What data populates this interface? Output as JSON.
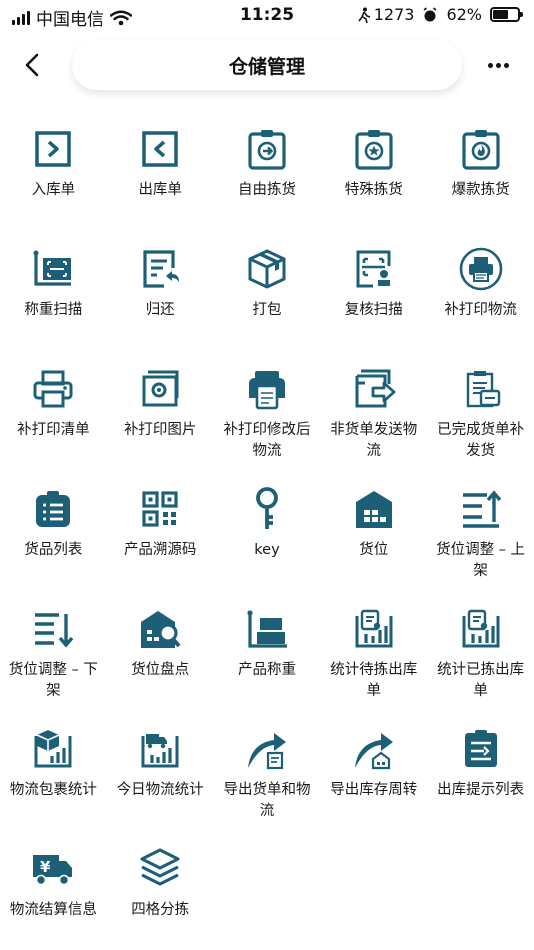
{
  "status": {
    "carrier": "中国电信",
    "time": "11:25",
    "steps": "1273",
    "battery": "62%",
    "battery_level": 0.62
  },
  "nav": {
    "title": "仓储管理"
  },
  "colors": {
    "icon": "#1e5f78"
  },
  "items": [
    {
      "label": "入库单",
      "icon": "inbound-icon"
    },
    {
      "label": "出库单",
      "icon": "outbound-icon"
    },
    {
      "label": "自由拣货",
      "icon": "free-picking-icon"
    },
    {
      "label": "特殊拣货",
      "icon": "special-picking-icon"
    },
    {
      "label": "爆款拣货",
      "icon": "hot-picking-icon"
    },
    {
      "label": "称重扫描",
      "icon": "weigh-scan-icon"
    },
    {
      "label": "归还",
      "icon": "return-icon"
    },
    {
      "label": "打包",
      "icon": "package-icon"
    },
    {
      "label": "复核扫描",
      "icon": "recheck-scan-icon"
    },
    {
      "label": "补打印物流",
      "icon": "reprint-logistics-icon"
    },
    {
      "label": "补打印清单",
      "icon": "reprint-list-icon"
    },
    {
      "label": "补打印图片",
      "icon": "reprint-image-icon"
    },
    {
      "label": "补打印修改后物流",
      "icon": "reprint-modified-icon"
    },
    {
      "label": "非货单发送物流",
      "icon": "send-logistics-icon"
    },
    {
      "label": "已完成货单补发货",
      "icon": "completed-reship-icon"
    },
    {
      "label": "货品列表",
      "icon": "goods-list-icon"
    },
    {
      "label": "产品溯源码",
      "icon": "qr-code-icon"
    },
    {
      "label": "key",
      "icon": "key-icon"
    },
    {
      "label": "货位",
      "icon": "warehouse-icon"
    },
    {
      "label": "货位调整 – 上架",
      "icon": "sort-up-icon"
    },
    {
      "label": "货位调整 – 下架",
      "icon": "sort-down-icon"
    },
    {
      "label": "货位盘点",
      "icon": "inventory-check-icon"
    },
    {
      "label": "产品称重",
      "icon": "product-weigh-icon"
    },
    {
      "label": "统计待拣出库单",
      "icon": "stats-pending-icon"
    },
    {
      "label": "统计已拣出库单",
      "icon": "stats-picked-icon"
    },
    {
      "label": "物流包裹统计",
      "icon": "parcel-stats-icon"
    },
    {
      "label": "今日物流统计",
      "icon": "today-stats-icon"
    },
    {
      "label": "导出货单和物流",
      "icon": "export-orders-icon"
    },
    {
      "label": "导出库存周转",
      "icon": "export-turnover-icon"
    },
    {
      "label": "出库提示列表",
      "icon": "outbound-tips-icon"
    },
    {
      "label": "物流结算信息",
      "icon": "settlement-icon"
    },
    {
      "label": "四格分拣",
      "icon": "layers-icon"
    }
  ]
}
